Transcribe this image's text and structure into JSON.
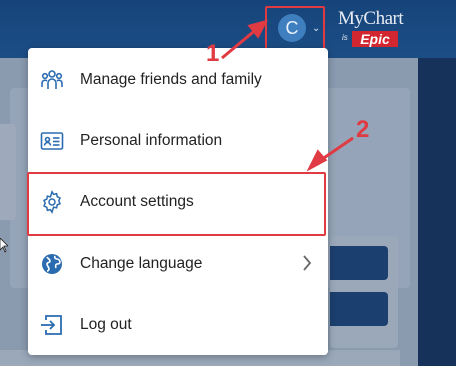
{
  "header": {
    "avatar_initial": "C",
    "logo_my": "MyChart",
    "logo_is": "is",
    "logo_epic": "Epic"
  },
  "menu": {
    "items": [
      {
        "label": "Manage friends and family",
        "icon": "people-icon"
      },
      {
        "label": "Personal information",
        "icon": "id-card-icon"
      },
      {
        "label": "Account settings",
        "icon": "gear-icon"
      },
      {
        "label": "Change language",
        "icon": "globe-icon"
      },
      {
        "label": "Log out",
        "icon": "logout-icon"
      }
    ]
  },
  "annotations": {
    "step1": "1",
    "step2": "2"
  },
  "colors": {
    "header": "#1c4e86",
    "accent": "#2b6cb0",
    "highlight": "#e03a42"
  }
}
